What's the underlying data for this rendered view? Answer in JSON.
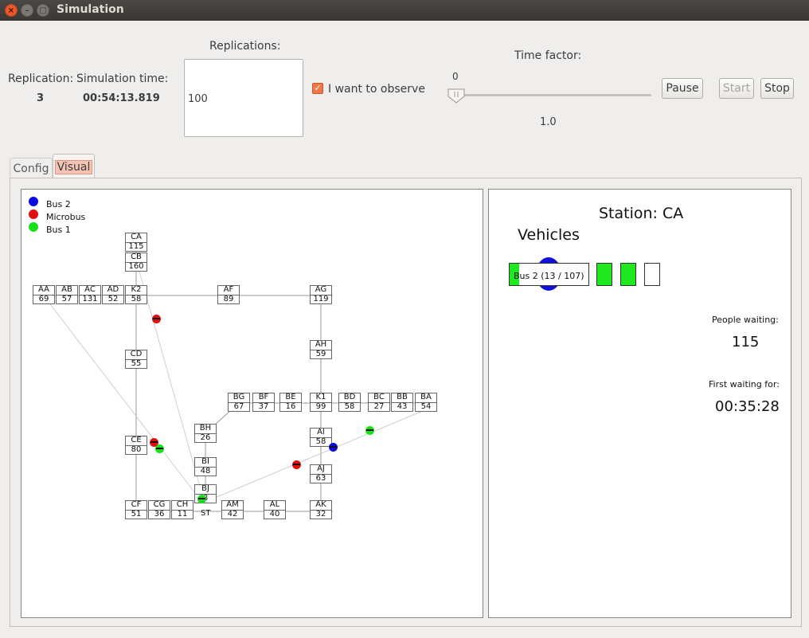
{
  "window": {
    "title": "Simulation"
  },
  "header": {
    "replication_label": "Replication:",
    "replication_value": "3",
    "sim_time_label": "Simulation time:",
    "sim_time_value": "00:54:13.819",
    "replications_label": "Replications:",
    "replications_value": "100",
    "observe_label": "I want to observe",
    "observe_checked": true,
    "time_factor_label": "Time factor:",
    "slider_min_label": "0",
    "slider_value_label": "1.0",
    "pause_label": "Pause",
    "start_label": "Start",
    "stop_label": "Stop"
  },
  "tabs": [
    {
      "label": "Config",
      "active": false
    },
    {
      "label": "Visual",
      "active": true
    }
  ],
  "legend": [
    {
      "label": "Bus 2",
      "color": "#0a0ae0"
    },
    {
      "label": "Microbus",
      "color": "#e01010"
    },
    {
      "label": "Bus 1",
      "color": "#18e018"
    }
  ],
  "stations": [
    {
      "name": "CA",
      "count": "115"
    },
    {
      "name": "CB",
      "count": "160"
    },
    {
      "name": "AA",
      "count": "69"
    },
    {
      "name": "AB",
      "count": "57"
    },
    {
      "name": "AC",
      "count": "131"
    },
    {
      "name": "AD",
      "count": "52"
    },
    {
      "name": "K2",
      "count": "58"
    },
    {
      "name": "AF",
      "count": "89"
    },
    {
      "name": "AG",
      "count": "119"
    },
    {
      "name": "AH",
      "count": "59"
    },
    {
      "name": "CD",
      "count": "55"
    },
    {
      "name": "BG",
      "count": "67"
    },
    {
      "name": "BF",
      "count": "37"
    },
    {
      "name": "BE",
      "count": "16"
    },
    {
      "name": "K1",
      "count": "99"
    },
    {
      "name": "BD",
      "count": "58"
    },
    {
      "name": "BC",
      "count": "27"
    },
    {
      "name": "BB",
      "count": "43"
    },
    {
      "name": "BA",
      "count": "54"
    },
    {
      "name": "BH",
      "count": "26"
    },
    {
      "name": "AI",
      "count": "58"
    },
    {
      "name": "CE",
      "count": "80"
    },
    {
      "name": "BI",
      "count": "48"
    },
    {
      "name": "AJ",
      "count": "63"
    },
    {
      "name": "BJ",
      "count": "8"
    },
    {
      "name": "CF",
      "count": "51"
    },
    {
      "name": "CG",
      "count": "36"
    },
    {
      "name": "CH",
      "count": "11"
    },
    {
      "name": "AM",
      "count": "42"
    },
    {
      "name": "AL",
      "count": "40"
    },
    {
      "name": "AK",
      "count": "32"
    }
  ],
  "start_station_label": "ST",
  "detail": {
    "station_title": "Station: CA",
    "vehicles_label": "Vehicles",
    "bus_label": "Bus 2 (13 / 107)",
    "bus_fill_fraction": 0.12,
    "people_waiting_label": "People waiting:",
    "people_waiting_value": "115",
    "first_waiting_label": "First waiting for:",
    "first_waiting_value": "00:35:28"
  },
  "colors": {
    "accent": "#ef7646",
    "bus2": "#0a0ae0",
    "microbus": "#e01010",
    "bus1": "#18e018"
  }
}
